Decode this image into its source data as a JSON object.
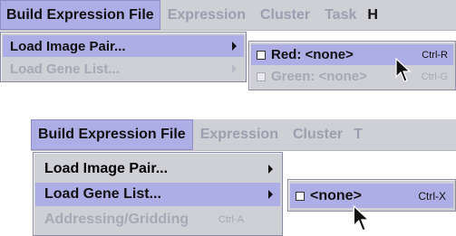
{
  "screens": [
    {
      "menubar": {
        "active": "Build Expression File",
        "inactive": [
          "Expression",
          "Cluster",
          "Task",
          "H"
        ]
      },
      "menu": {
        "items": [
          {
            "label": "Load Image Pair...",
            "enabled": true,
            "highlight": true,
            "submenu": true
          },
          {
            "label": "Load Gene List...",
            "enabled": false,
            "highlight": false,
            "submenu": true
          }
        ]
      },
      "submenu": {
        "items": [
          {
            "label": "Red: <none>",
            "accel": "Ctrl-R",
            "enabled": true,
            "highlight": true
          },
          {
            "label": "Green: <none>",
            "accel": "Ctrl-G",
            "enabled": false,
            "highlight": false
          }
        ]
      }
    },
    {
      "menubar": {
        "active": "Build Expression File",
        "inactive": [
          "Expression",
          "Cluster",
          "T"
        ]
      },
      "menu": {
        "items": [
          {
            "label": "Load Image Pair...",
            "enabled": true,
            "highlight": false,
            "submenu": true
          },
          {
            "label": "Load Gene List...",
            "enabled": true,
            "highlight": true,
            "submenu": true
          },
          {
            "label": "Addressing/Gridding",
            "accel": "Ctrl-A",
            "enabled": false,
            "highlight": false
          }
        ]
      },
      "submenu": {
        "items": [
          {
            "label": "<none>",
            "accel": "Ctrl-X",
            "enabled": true,
            "highlight": true
          }
        ]
      }
    }
  ]
}
